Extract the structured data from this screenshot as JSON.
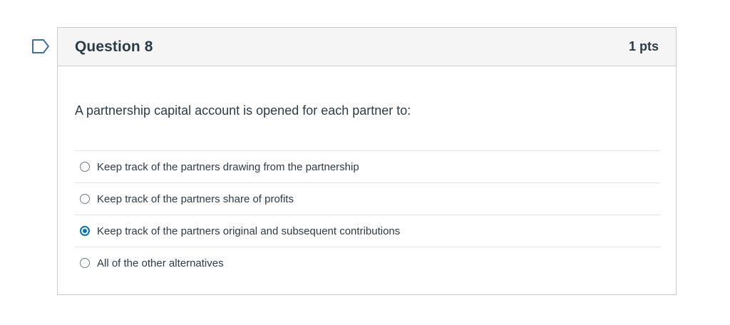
{
  "question": {
    "title": "Question 8",
    "points": "1 pts",
    "text": "A partnership capital account is opened for each partner to:",
    "answers": [
      {
        "label": "Keep track of the partners drawing from the partnership",
        "selected": false
      },
      {
        "label": "Keep track of the partners share of profits",
        "selected": false
      },
      {
        "label": "Keep track of the partners original and subsequent contributions",
        "selected": true
      },
      {
        "label": "All of the other alternatives",
        "selected": false
      }
    ]
  },
  "colors": {
    "accent": "#0374b5",
    "header_bg": "#f5f5f5",
    "border": "#c7cdd1",
    "text": "#2d3b45",
    "flag_icon": "#3b6fb4"
  },
  "icons": {
    "flag": "flag-question-icon"
  }
}
